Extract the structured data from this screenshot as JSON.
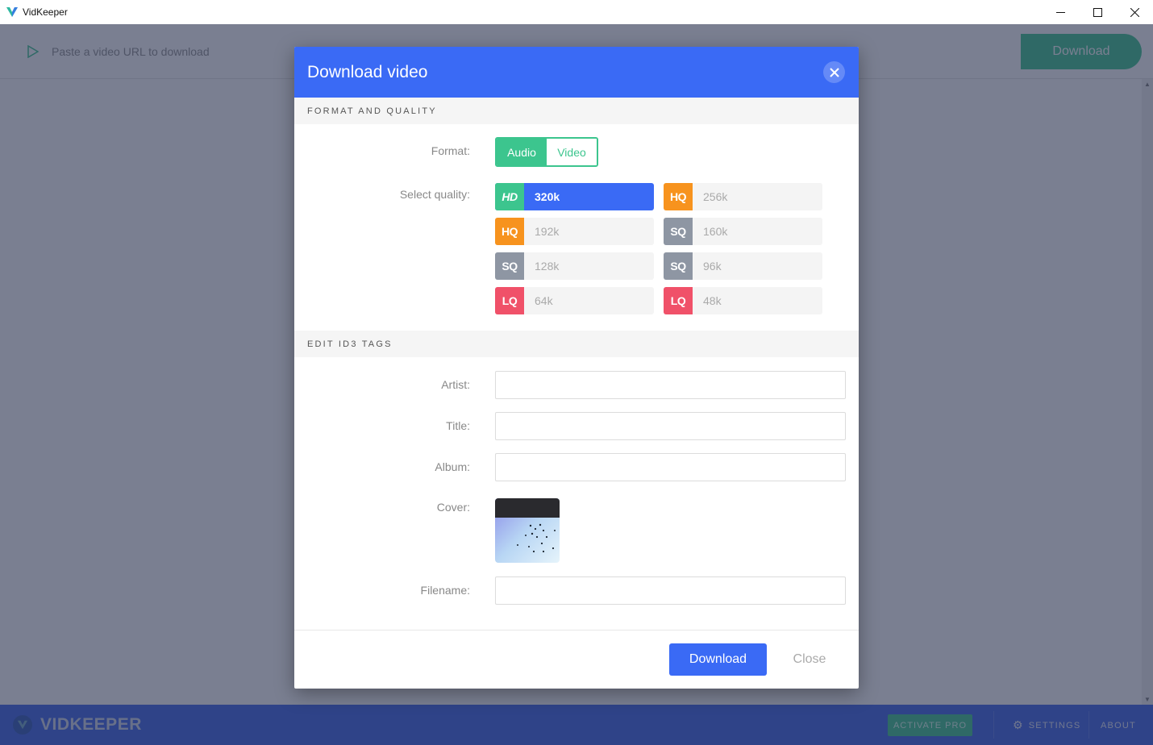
{
  "window": {
    "title": "VidKeeper",
    "controls": {
      "minimize": "—",
      "maximize": "☐",
      "close": "✕"
    }
  },
  "app": {
    "url_placeholder": "Paste a video URL to download",
    "download_label": "Download",
    "footer": {
      "brand": "VIDKEEPER",
      "activate_pro": "ACTIVATE PRO",
      "settings": "SETTINGS",
      "about": "ABOUT"
    }
  },
  "dialog": {
    "title": "Download video",
    "close_icon": "close-icon",
    "sections": {
      "format_quality": "FORMAT AND QUALITY",
      "id3_tags": "EDIT ID3 TAGS"
    },
    "format": {
      "label": "Format:",
      "options": [
        "Audio",
        "Video"
      ],
      "selected": "Audio"
    },
    "quality": {
      "label": "Select quality:",
      "selected": "320k",
      "options": [
        {
          "badge": "HD",
          "value": "320k",
          "color": "#3cc58e"
        },
        {
          "badge": "HQ",
          "value": "256k",
          "color": "#f7931e"
        },
        {
          "badge": "HQ",
          "value": "192k",
          "color": "#f7931e"
        },
        {
          "badge": "SQ",
          "value": "160k",
          "color": "#8e96a3"
        },
        {
          "badge": "SQ",
          "value": "128k",
          "color": "#8e96a3"
        },
        {
          "badge": "SQ",
          "value": "96k",
          "color": "#8e96a3"
        },
        {
          "badge": "LQ",
          "value": "64k",
          "color": "#f05169"
        },
        {
          "badge": "LQ",
          "value": "48k",
          "color": "#f05169"
        }
      ]
    },
    "tags": {
      "artist": {
        "label": "Artist:",
        "value": ""
      },
      "title": {
        "label": "Title:",
        "value": ""
      },
      "album": {
        "label": "Album:",
        "value": ""
      },
      "cover": {
        "label": "Cover:"
      },
      "filename": {
        "label": "Filename:",
        "value": ""
      }
    },
    "buttons": {
      "download": "Download",
      "close": "Close"
    }
  }
}
